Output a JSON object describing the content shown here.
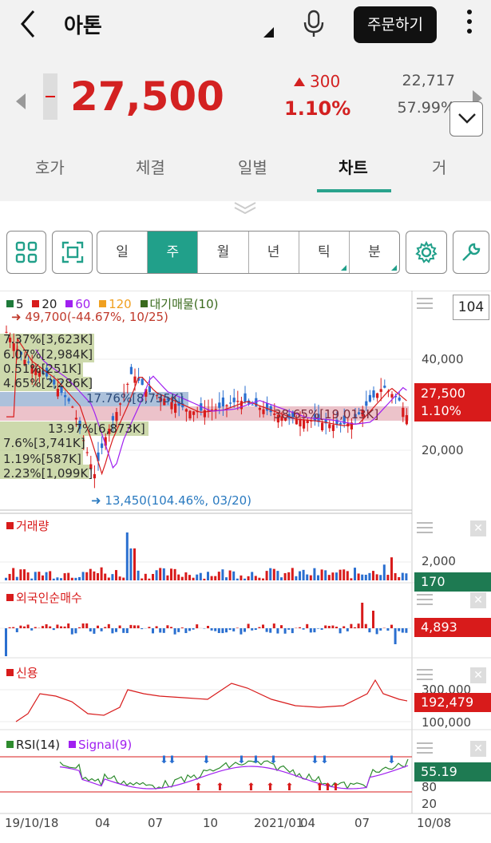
{
  "header": {
    "title": "아톤",
    "order_label": "주문하기"
  },
  "quote": {
    "price": "27,500",
    "change": "300",
    "change_pct": "1.10%",
    "volume": "22,717",
    "volume_ratio": "57.99%"
  },
  "tabs": [
    {
      "label": "호가"
    },
    {
      "label": "체결"
    },
    {
      "label": "일별"
    },
    {
      "label": "차트"
    },
    {
      "label": "거"
    }
  ],
  "periods": [
    {
      "label": "일"
    },
    {
      "label": "주"
    },
    {
      "label": "월"
    },
    {
      "label": "년"
    },
    {
      "label": "틱"
    },
    {
      "label": "분"
    }
  ],
  "zoom_value": "104",
  "price_panel": {
    "legend": [
      "5",
      "20",
      "60",
      "120",
      "대기매물(10)"
    ],
    "high_note": "49,700(-44.67%, 10/25)",
    "low_note": "13,450(104.46%, 03/20)",
    "axis": [
      "40,000",
      "20,000"
    ],
    "price_tag": "27,500",
    "pct_tag": "1.10%",
    "profile_labels": [
      "7.37%[3,623K]",
      "6.07%[2,984K]",
      "0.51%[251K]",
      "4.65%[2,286K]",
      "17.76%[8,735K]",
      "38.65%[19,013K]",
      "13.97%[6,873K]",
      "7.6%[3,741K]",
      "1.19%[587K]",
      "2.23%[1,099K]"
    ]
  },
  "volume_panel": {
    "title": "거래량",
    "axis": "2,000",
    "tag": "170"
  },
  "foreign_panel": {
    "title": "외국인순매수",
    "tag": "4,893"
  },
  "credit_panel": {
    "title": "신용",
    "axis": [
      "300,000",
      "100,000"
    ],
    "tag": "192,479"
  },
  "rsi_panel": {
    "legend": [
      "RSI(14)",
      "Signal(9)"
    ],
    "axis": [
      "80",
      "20"
    ],
    "tag": "55.19"
  },
  "x_axis": [
    "19/10/18",
    "04",
    "07",
    "10",
    "2021/01",
    "04",
    "07",
    "10/08"
  ],
  "colors": {
    "up": "#d32121",
    "accent": "#21a08a",
    "ma5": "#1e7a3a",
    "ma20": "#d81b1b",
    "ma60": "#a020f0",
    "ma120": "#f0a020",
    "profile": "#3b6b1e"
  },
  "chart_data": {
    "type": "candlestick",
    "x": [
      "19/10/18",
      "04",
      "07",
      "10",
      "2021/01",
      "04",
      "07",
      "10/08"
    ],
    "high": 49700,
    "low": 13450,
    "last": 27500
  }
}
